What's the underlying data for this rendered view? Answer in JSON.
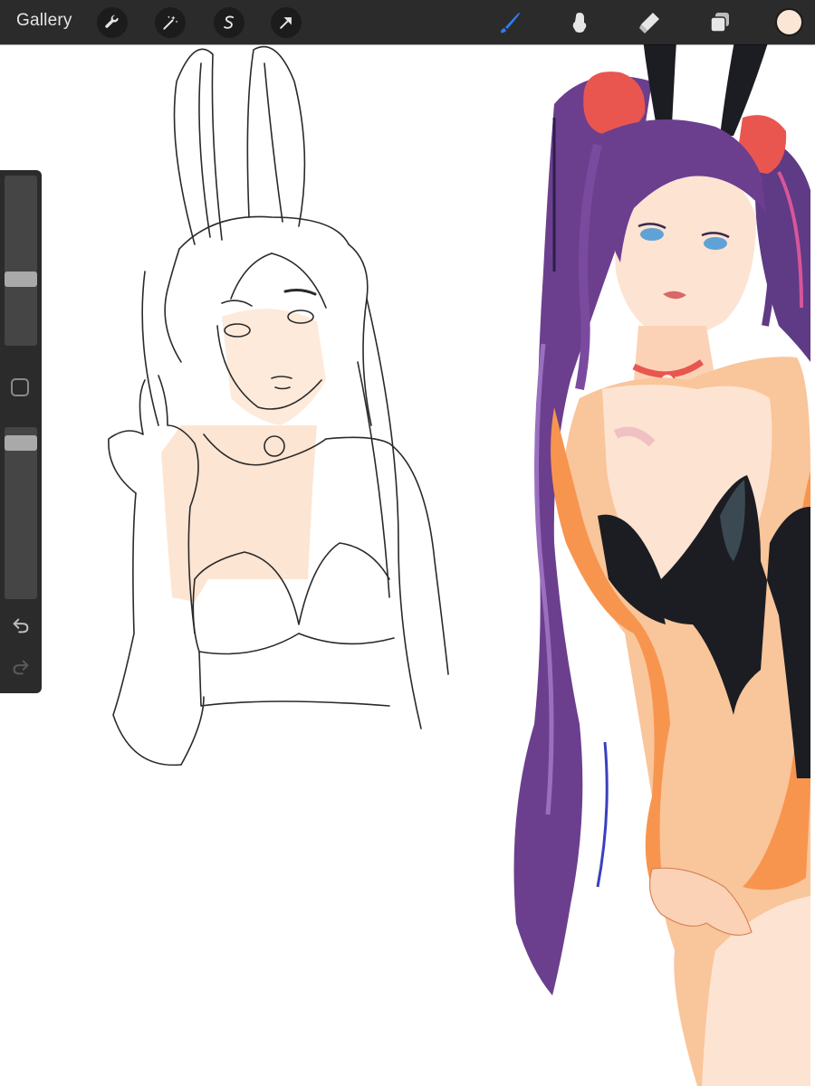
{
  "toolbar": {
    "gallery_label": "Gallery",
    "left_tools": [
      {
        "name": "actions",
        "icon": "wrench-icon"
      },
      {
        "name": "adjustments",
        "icon": "magic-wand-icon"
      },
      {
        "name": "selection",
        "icon": "selection-s-icon"
      },
      {
        "name": "transform",
        "icon": "arrow-cursor-icon"
      }
    ],
    "right_tools": [
      {
        "name": "brush",
        "icon": "brush-icon",
        "active": true
      },
      {
        "name": "smudge",
        "icon": "smudge-finger-icon",
        "active": false
      },
      {
        "name": "eraser",
        "icon": "eraser-icon",
        "active": false
      },
      {
        "name": "layers",
        "icon": "layers-icon",
        "active": false
      }
    ],
    "current_color": "#fbe6d6",
    "active_tool_color": "#2f7cf6"
  },
  "sidebar": {
    "brush_size_level": 0.38,
    "opacity_level": 0.05,
    "buttons": [
      {
        "name": "modify",
        "icon": "square-modify-icon"
      },
      {
        "name": "undo",
        "icon": "undo-icon"
      },
      {
        "name": "redo",
        "icon": "redo-icon"
      }
    ]
  },
  "colors": {
    "toolbar_bg": "#2b2b2b",
    "icon_light": "#e6e6e6",
    "hair_purple": "#6b3f8e",
    "skin_peach": "#f9c59a",
    "skin_light": "#fde3d2",
    "suit_black": "#1b1d22",
    "bow_red": "#e9564f"
  }
}
